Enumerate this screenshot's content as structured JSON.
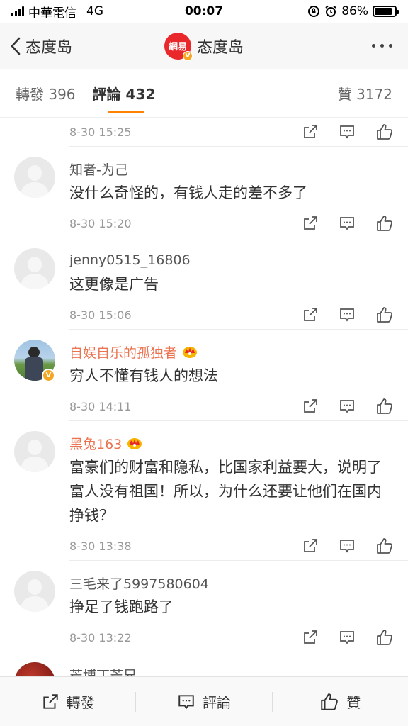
{
  "status_bar": {
    "carrier": "中華電信",
    "network": "4G",
    "time": "00:07",
    "battery_percent": "86%",
    "battery_level": 0.86
  },
  "nav": {
    "back_label": "态度岛",
    "avatar_text": "網易",
    "title": "态度岛"
  },
  "tabs": {
    "repost": "轉發 396",
    "comments": "評論 432",
    "likes": "贊 3172"
  },
  "comments": {
    "top_partial_time": "8-30 15:25",
    "items": [
      {
        "name": "知者-为己",
        "text": "没什么奇怪的，有钱人走的差不多了",
        "time": "8-30 15:20"
      },
      {
        "name": "jenny0515_16806",
        "text": "这更像是广告",
        "time": "8-30 15:06"
      },
      {
        "name": "自娱自乐的孤独者",
        "text": "穷人不懂有钱人的想法",
        "time": "8-30 14:11"
      },
      {
        "name": "黑兔163",
        "text": "富豪们的财富和隐私，比国家利益要大，说明了富人没有祖国！所以，为什么还要让他们在国内挣钱？",
        "time": "8-30 13:38"
      },
      {
        "name": "三毛来了5997580604",
        "text": "挣足了钱跑路了",
        "time": "8-30 13:22"
      }
    ],
    "partial_name": "芒博丁芒兄"
  },
  "bottom_bar": {
    "repost": "轉發",
    "comment": "評論",
    "like": "贊"
  },
  "colors": {
    "accent": "#ff8200",
    "vip_name": "#eb7350",
    "verified_badge": "#f5a623"
  }
}
